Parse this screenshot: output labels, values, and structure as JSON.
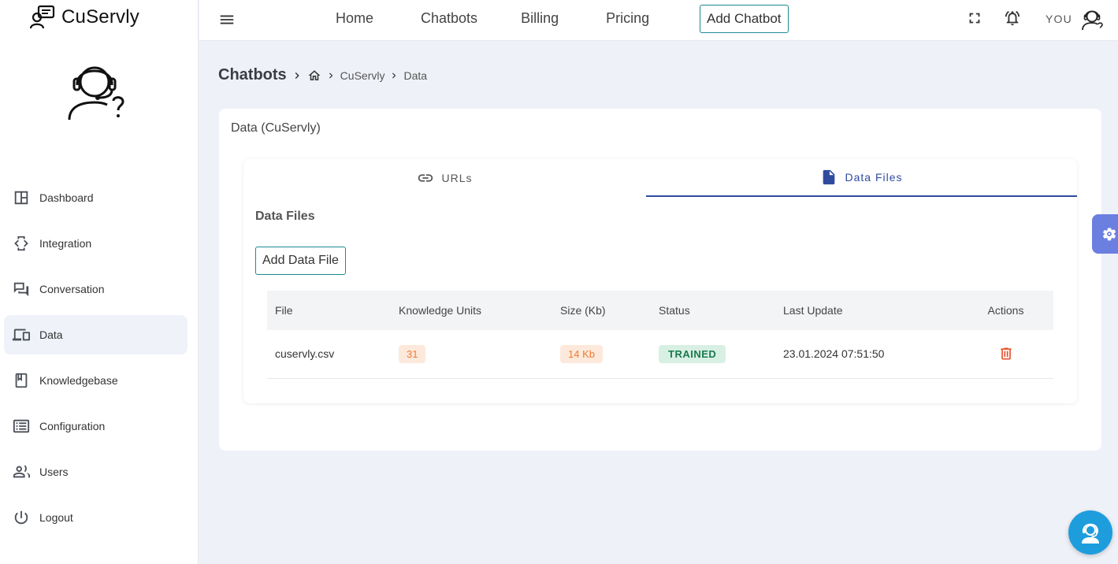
{
  "brand": {
    "name": "CuServly"
  },
  "sidebar": {
    "items": [
      {
        "label": "Dashboard",
        "icon": "dashboard-icon"
      },
      {
        "label": "Integration",
        "icon": "integration-icon"
      },
      {
        "label": "Conversation",
        "icon": "conversation-icon"
      },
      {
        "label": "Data",
        "icon": "devices-icon",
        "active": true
      },
      {
        "label": "Knowledgebase",
        "icon": "book-icon"
      },
      {
        "label": "Configuration",
        "icon": "list-icon"
      },
      {
        "label": "Users",
        "icon": "users-icon"
      },
      {
        "label": "Logout",
        "icon": "power-icon"
      }
    ]
  },
  "topbar": {
    "nav": [
      "Home",
      "Chatbots",
      "Billing",
      "Pricing"
    ],
    "add_chatbot": "Add Chatbot",
    "user_label": "YOU"
  },
  "breadcrumb": {
    "title": "Chatbots",
    "items": [
      "CuServly",
      "Data"
    ]
  },
  "card": {
    "title": "Data (CuServly)",
    "tabs": [
      {
        "label": "URLs",
        "icon": "link-icon"
      },
      {
        "label": "Data Files",
        "icon": "file-icon",
        "active": true
      }
    ],
    "section_title": "Data Files",
    "add_button": "Add Data File",
    "table": {
      "headers": [
        "File",
        "Knowledge Units",
        "Size (Kb)",
        "Status",
        "Last Update",
        "Actions"
      ],
      "rows": [
        {
          "file": "cuservly.csv",
          "units": "31",
          "size": "14 Kb",
          "status": "TRAINED",
          "updated": "23.01.2024 07:51:50"
        }
      ]
    }
  },
  "colors": {
    "accent": "#2f4ba0",
    "teal_border": "#1b8a95",
    "fab_blue": "#1e9ddd",
    "settings_fab": "#6b7fe0",
    "delete": "#e8522a"
  }
}
